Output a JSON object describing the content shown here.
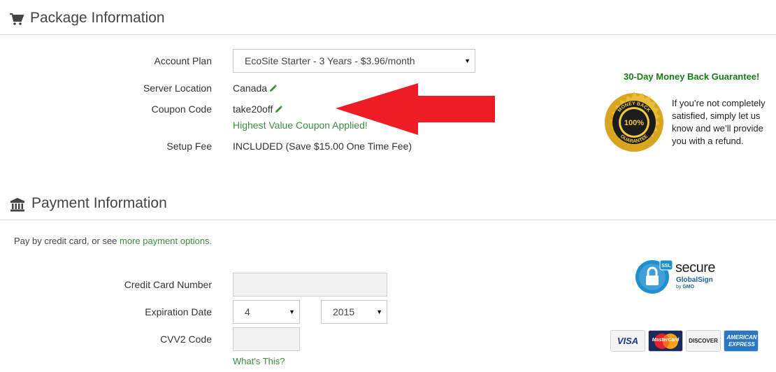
{
  "package": {
    "title": "Package Information",
    "icon": "cart-icon",
    "account_plan_label": "Account Plan",
    "account_plan_value": "EcoSite Starter - 3 Years - $3.96/month",
    "server_location_label": "Server Location",
    "server_location_value": "Canada",
    "coupon_code_label": "Coupon Code",
    "coupon_code_value": "take20off",
    "coupon_status": "Highest Value Coupon Applied!",
    "setup_fee_label": "Setup Fee",
    "setup_fee_value": "INCLUDED (Save $15.00 One Time Fee)",
    "edit_icon": "pencil-icon"
  },
  "guarantee": {
    "title": "30-Day Money Back Guarantee!",
    "badge_top": "MONEY BACK",
    "badge_center": "100%",
    "badge_bottom": "GUARANTEE",
    "text_line1": "If you’re not completely",
    "text_line2": "satisfied, simply let us",
    "text_line3": "know and we’ll provide",
    "text_line4": "you with a refund."
  },
  "payment": {
    "title": "Payment Information",
    "icon": "bank-icon",
    "intro_text": "Pay by credit card, or see ",
    "intro_link": "more payment options.",
    "card_number_label": "Credit Card Number",
    "card_number_value": "",
    "expiration_label": "Expiration Date",
    "exp_month": "4",
    "exp_year": "2015",
    "cvv_label": "CVV2 Code",
    "cvv_value": "",
    "whats_this": "What's This?"
  },
  "secure_badge": {
    "ssl": "SSL",
    "secure": "secure",
    "brand": "GlobalSign",
    "by": "by",
    "gmo": "GMO"
  },
  "cards": [
    "VISA",
    "MasterCard",
    "DISCOVER",
    "AMERICAN EXPRESS"
  ],
  "colors": {
    "green_link": "#3c8b3c",
    "guarantee_green": "#1a7a1a",
    "arrow_red": "#ee1c25",
    "ssl_blue": "#1f8fd0"
  }
}
